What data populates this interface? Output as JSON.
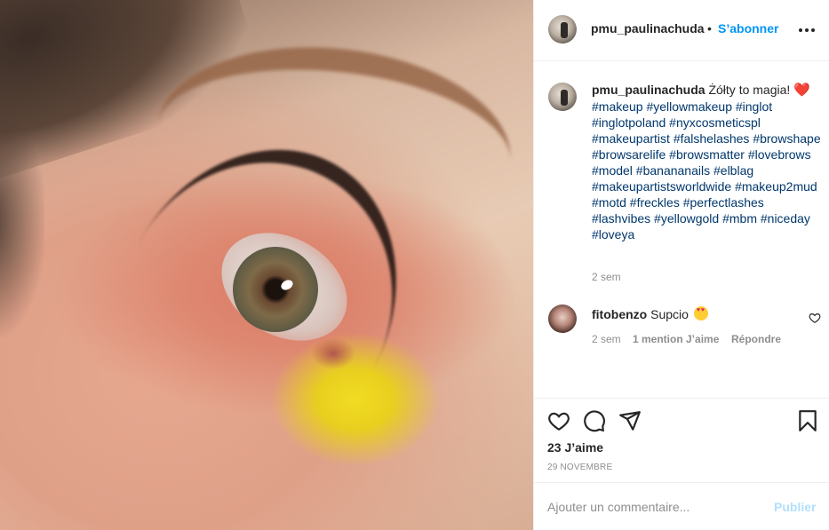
{
  "post": {
    "username": "pmu_paulinachuda",
    "separator": "•",
    "follow_label": "S’abonner",
    "more_icon": "more-horizontal-icon"
  },
  "caption": {
    "username": "pmu_paulinachuda",
    "text": "Żółty to magia! ",
    "emoji": "❤️",
    "hashtags": "#makeup #yellowmakeup #inglot #inglotpoland #nyxcosmeticspl #makeupartist #falshelashes #browshape #browsarelife #browsmatter #lovebrows #model #banananails #elblag #makeupartistsworldwide #makeup2mud #motd #freckles #perfectlashes #lashvibes #yellowgold #mbm #niceday #loveya",
    "time": "2 sem"
  },
  "comments": [
    {
      "username": "fitobenzo",
      "text": "Supcio",
      "emoji": "heart-eyes-emoji",
      "time": "2 sem",
      "likes": "1 mention J’aime",
      "reply_label": "Répondre"
    }
  ],
  "actions": {
    "likes": "23 J’aime",
    "date": "29 NOVEMBRE"
  },
  "add_comment": {
    "placeholder": "Ajouter un commentaire...",
    "value": "",
    "publish_label": "Publier"
  },
  "colors": {
    "link_blue": "#0095f6",
    "hashtag_blue": "#00376b",
    "muted": "#8e8e8e",
    "publish_disabled": "#b2dffc"
  }
}
